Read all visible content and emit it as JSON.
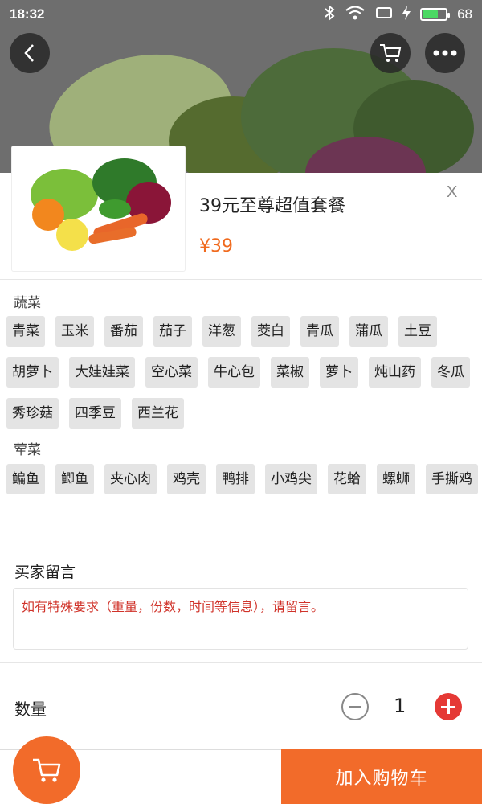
{
  "status_bar": {
    "time": "18:32",
    "battery": "68",
    "battery_fraction": 0.68
  },
  "product": {
    "title": "39元至尊超值套餐",
    "price": "¥39",
    "close_label": "X"
  },
  "groups": [
    {
      "label": "蔬菜",
      "tags": [
        "青菜",
        "玉米",
        "番茄",
        "茄子",
        "洋葱",
        "茭白",
        "青瓜",
        "蒲瓜",
        "土豆",
        "胡萝卜",
        "大娃娃菜",
        "空心菜",
        "牛心包",
        "菜椒",
        "萝卜",
        "炖山药",
        "冬瓜",
        "秀珍菇",
        "四季豆",
        "西兰花"
      ]
    },
    {
      "label": "荤菜",
      "tags": [
        "鳊鱼",
        "鲫鱼",
        "夹心肉",
        "鸡壳",
        "鸭排",
        "小鸡尖",
        "花蛤",
        "螺蛳",
        "手撕鸡"
      ]
    }
  ],
  "message": {
    "title": "买家留言",
    "placeholder": "如有特殊要求（重量，份数，时间等信息），请留言。"
  },
  "quantity": {
    "label": "数量",
    "value": "1"
  },
  "footer": {
    "add_to_cart": "加入购物车"
  },
  "colors": {
    "accent": "#f26b2a",
    "price": "#f06a1e",
    "plus": "#e53935",
    "placeholder": "#d0332a"
  }
}
